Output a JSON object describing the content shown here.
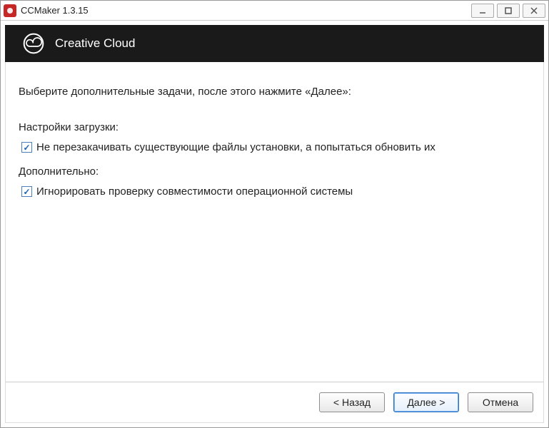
{
  "titlebar": {
    "title": "CCMaker 1.3.15"
  },
  "header": {
    "title": "Creative Cloud"
  },
  "content": {
    "intro": "Выберите дополнительные задачи, после этого нажмите «Далее»:",
    "section1_label": "Настройки загрузки:",
    "checkbox1_label": "Не перезакачивать существующие файлы установки, а попытаться обновить их",
    "section2_label": "Дополнительно:",
    "checkbox2_label": "Игнорировать проверку совместимости операционной системы"
  },
  "footer": {
    "back": "< Назад",
    "next": "Далее >",
    "cancel": "Отмена"
  }
}
